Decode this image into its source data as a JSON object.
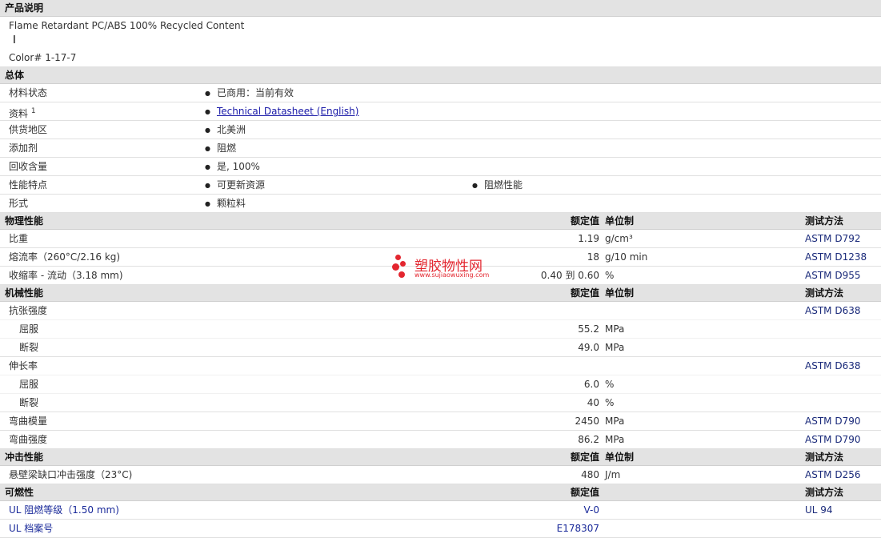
{
  "description": {
    "header": "产品说明",
    "line1": "Flame Retardant PC/ABS 100% Recycled Content",
    "line2": "Color# 1-17-7"
  },
  "general": {
    "header": "总体",
    "rows": [
      {
        "label": "材料状态",
        "b1": "已商用：当前有效"
      },
      {
        "label": "资料",
        "sup": "1",
        "b1": "Technical Datasheet (English)"
      },
      {
        "label": "供货地区",
        "b1": "北美洲"
      },
      {
        "label": "添加剂",
        "b1": "阻燃"
      },
      {
        "label": "回收含量",
        "b1": "是, 100%"
      },
      {
        "label": "性能特点",
        "b1": "可更新资源",
        "b2": "阻燃性能"
      },
      {
        "label": "形式",
        "b1": "颗粒料"
      }
    ]
  },
  "physical": {
    "header": "物理性能",
    "col_value": "额定值",
    "col_unit": "单位制",
    "col_method": "测试方法",
    "rows": [
      {
        "label": "比重",
        "value": "1.19",
        "unit": "g/cm³",
        "method": "ASTM D792"
      },
      {
        "label": "熔流率（260°C/2.16 kg)",
        "value": "18",
        "unit": "g/10 min",
        "method": "ASTM D1238"
      },
      {
        "label": "收缩率 - 流动（3.18 mm)",
        "value": "0.40 到 0.60",
        "unit": "%",
        "method": "ASTM D955"
      }
    ]
  },
  "mechanical": {
    "header": "机械性能",
    "col_value": "额定值",
    "col_unit": "单位制",
    "col_method": "测试方法",
    "rows": [
      {
        "label": "抗张强度",
        "method": "ASTM D638"
      },
      {
        "label": "屈服",
        "value": "55.2",
        "unit": "MPa"
      },
      {
        "label": "断裂",
        "value": "49.0",
        "unit": "MPa"
      },
      {
        "label": "伸长率",
        "method": "ASTM D638"
      },
      {
        "label": "屈服",
        "value": "6.0",
        "unit": "%"
      },
      {
        "label": "断裂",
        "value": "40",
        "unit": "%"
      },
      {
        "label": "弯曲模量",
        "value": "2450",
        "unit": "MPa",
        "method": "ASTM D790"
      },
      {
        "label": "弯曲强度",
        "value": "86.2",
        "unit": "MPa",
        "method": "ASTM D790"
      }
    ]
  },
  "impact": {
    "header": "冲击性能",
    "col_value": "额定值",
    "col_unit": "单位制",
    "col_method": "测试方法",
    "rows": [
      {
        "label": "悬壁梁缺口冲击强度（23°C)",
        "value": "480",
        "unit": "J/m",
        "method": "ASTM D256"
      }
    ]
  },
  "flammability": {
    "header": "可燃性",
    "col_value": "额定值",
    "col_method": "测试方法",
    "rows": [
      {
        "label": "UL 阻燃等级（1.50 mm)",
        "value": "V-0",
        "method": "UL 94"
      },
      {
        "label": "UL 档案号",
        "value": "E178307"
      }
    ]
  },
  "watermark": {
    "name": "塑胶物性网",
    "url": "www.sujiaowuxing.com"
  },
  "colors": {
    "header_bg": "#e3e3e3",
    "link": "#1a1aa8",
    "watermark": "#e3262f"
  }
}
